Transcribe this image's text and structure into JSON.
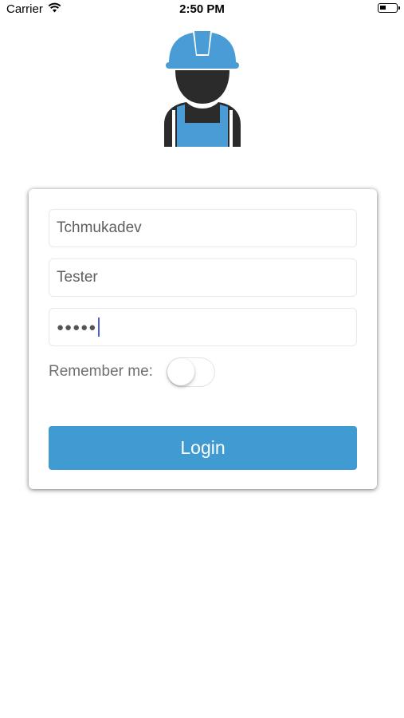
{
  "status_bar": {
    "carrier": "Carrier",
    "time": "2:50 PM",
    "wifi_icon": "wifi-icon",
    "battery_icon": "battery-icon"
  },
  "logo": {
    "icon": "construction-worker-icon"
  },
  "form": {
    "username_value": "Tchmukadev",
    "server_value": "Tester",
    "password_value": "●●●●●",
    "remember_label": "Remember me:",
    "remember_on": false,
    "login_label": "Login"
  },
  "colors": {
    "accent": "#409bd2",
    "helmet_blue": "#4a9cd6",
    "worker_dark": "#2b2b2b"
  }
}
